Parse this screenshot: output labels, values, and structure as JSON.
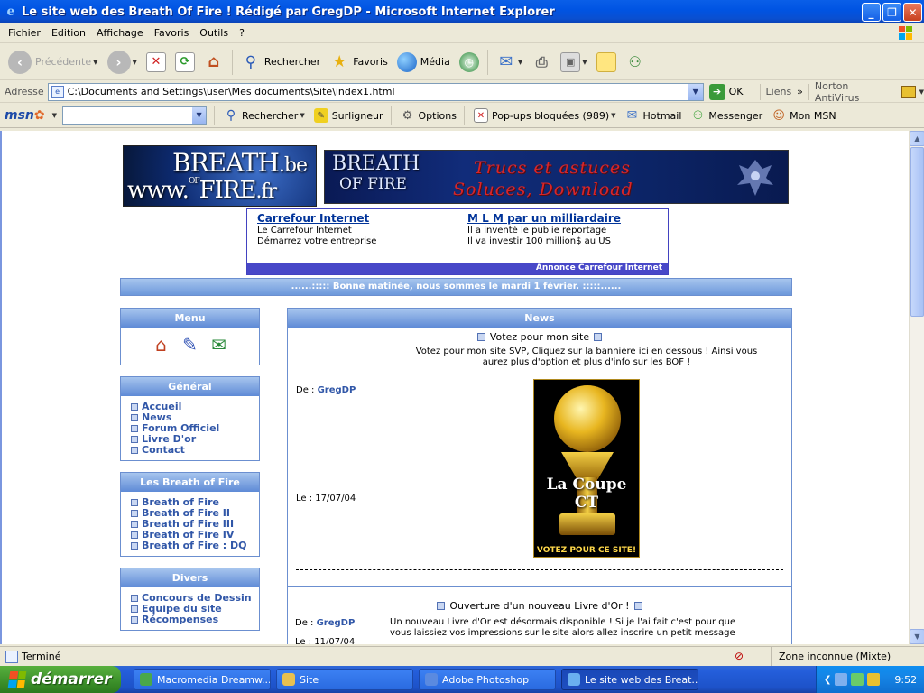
{
  "window": {
    "title": "Le site web des Breath Of Fire ! Rédigé par GregDP - Microsoft Internet Explorer",
    "minimize": "_",
    "maximize": "❐",
    "close": "✕"
  },
  "menubar": [
    "Fichier",
    "Edition",
    "Affichage",
    "Favoris",
    "Outils",
    "?"
  ],
  "toolbar": {
    "back": "Précédente",
    "search": "Rechercher",
    "favorites": "Favoris",
    "media": "Média"
  },
  "address": {
    "label": "Adresse",
    "value": "C:\\Documents and Settings\\user\\Mes documents\\Site\\index1.html",
    "go": "OK",
    "links": "Liens",
    "norton": "Norton AntiVirus"
  },
  "msn": {
    "logo_a": "msn",
    "search": "Rechercher",
    "highlighter": "Surligneur",
    "options": "Options",
    "popups": "Pop-ups bloquées (989)",
    "hotmail": "Hotmail",
    "messenger": "Messenger",
    "mymsn": "Mon MSN"
  },
  "page": {
    "banner_left": {
      "l1": "BREATH",
      "l1_suffix": ".be",
      "l2a": "www.",
      "l2b": "FIRE",
      "l2_suffix": ".fr",
      "of": "OF"
    },
    "banner_right": {
      "logo1": "BREATH",
      "logo2": "OF FIRE",
      "tag1": "Trucs et astuces",
      "tag2": "Soluces, Download"
    },
    "ad": {
      "col1": {
        "title": "Carrefour Internet",
        "line1": "Le Carrefour Internet",
        "line2": "Démarrez votre entreprise"
      },
      "col2": {
        "title": "M L M par un milliardaire",
        "line1": "Il a inventé le publie reportage",
        "line2": "Il va investir 100 million$ au US"
      },
      "footer": "Annonce Carrefour Internet"
    },
    "greeting": "......::::: Bonne matinée, nous sommes le mardi 1 février. :::::......",
    "menu_box": {
      "title": "Menu"
    },
    "general": {
      "title": "Général",
      "items": [
        "Accueil",
        "News",
        "Forum Officiel",
        "Livre D'or",
        "Contact"
      ]
    },
    "bof": {
      "title": "Les Breath of Fire",
      "items": [
        "Breath of Fire",
        "Breath of Fire II",
        "Breath of Fire III",
        "Breath of Fire IV",
        "Breath of Fire : DQ"
      ]
    },
    "divers": {
      "title": "Divers",
      "items": [
        "Concours de Dessin",
        "Equipe du site",
        "Récompenses"
      ]
    },
    "news": {
      "title": "News",
      "item1": {
        "title": "Votez pour mon site",
        "body1": "Votez pour mon site SVP, Cliquez sur la bannière ici en dessous ! Ainsi vous",
        "body2": "aurez plus d'option et plus d'info sur les BOF !",
        "by_label": "De : ",
        "author": "GregDP",
        "date_label": "Le : ",
        "date": "17/07/04",
        "badge_name": "La Coupe CT",
        "badge_vote": "VOTEZ POUR CE SITE!"
      },
      "item2": {
        "title": "Ouverture d'un nouveau Livre d'Or !",
        "body1": "Un nouveau Livre d'Or est désormais disponible ! Si je l'ai fait c'est pour que",
        "body2": "vous laissiez vos impressions sur le site alors allez inscrire un petit message",
        "by_label": "De : ",
        "author": "GregDP",
        "date_label": "Le : ",
        "date": "11/07/04"
      }
    }
  },
  "status": {
    "text": "Terminé",
    "zone": "Zone inconnue (Mixte)"
  },
  "taskbar": {
    "start": "démarrer",
    "tasks": [
      "Macromedia Dreamw...",
      "Site",
      "Adobe Photoshop",
      "Le site web des Breat..."
    ],
    "clock": "9:52"
  },
  "colors": {
    "title_blue": "#0054e3",
    "panel_blue": "#6b8fd0",
    "link_blue": "#3157a8",
    "start_green": "#3c8f2a"
  }
}
